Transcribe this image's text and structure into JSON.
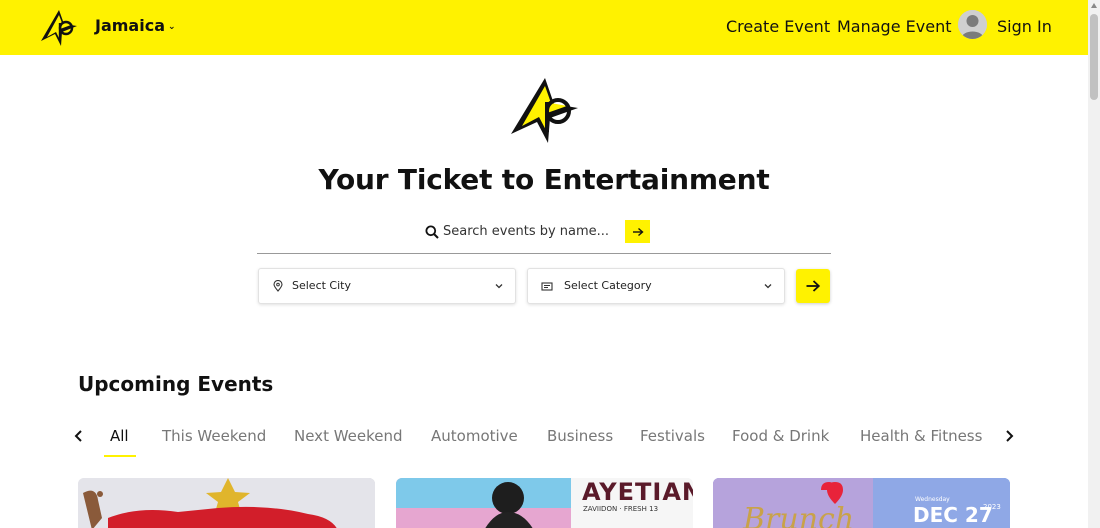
{
  "header": {
    "region": "Jamaica",
    "nav": {
      "create_event": "Create Event",
      "manage_event": "Manage Event",
      "sign_in": "Sign In"
    }
  },
  "hero": {
    "title": "Your Ticket to Entertainment",
    "search": {
      "placeholder": "Search events by name..."
    },
    "city_select": "Select City",
    "category_select": "Select Category"
  },
  "upcoming": {
    "title": "Upcoming Events",
    "tabs": [
      "All",
      "This Weekend",
      "Next Weekend",
      "Automotive",
      "Business",
      "Festivals",
      "Food & Drink",
      "Health & Fitness"
    ],
    "active_tab": "All",
    "cards": {
      "card2_headline": "AYETIAN",
      "card2_sub": "ZAVIIDON · FRESH 13",
      "card3_script": "Brunch",
      "card3_day": "Wednesday",
      "card3_date": "DEC 27",
      "card3_year": "2023"
    }
  },
  "colors": {
    "brand_yellow": "#fff200",
    "text": "#111111",
    "muted": "#777777"
  },
  "icons": {
    "logo": "ap-logo-icon",
    "search": "search-icon",
    "arrow": "arrow-right-icon",
    "location": "location-pin-icon",
    "category": "ticket-icon",
    "chevron": "chevron-down-icon"
  }
}
